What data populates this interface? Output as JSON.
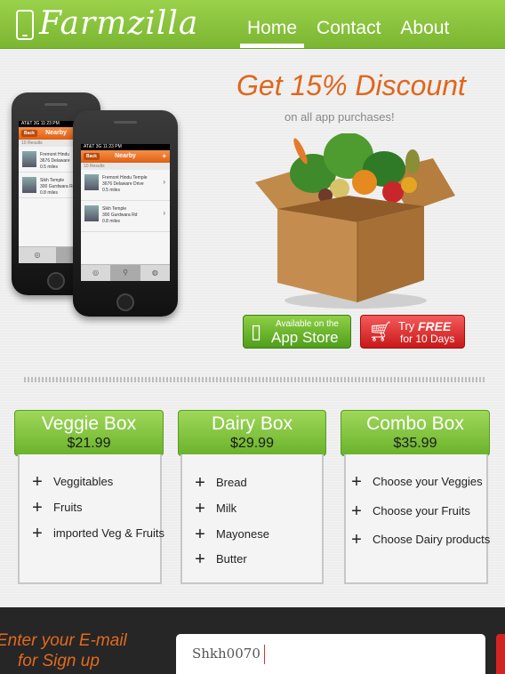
{
  "header": {
    "logo_text": "Farmzilla",
    "nav": [
      {
        "label": "Home",
        "active": true
      },
      {
        "label": "Contact",
        "active": false
      },
      {
        "label": "About",
        "active": false
      }
    ],
    "brand_color": "#86c23c"
  },
  "promo": {
    "title": "Get 15% Discount",
    "subtitle": "on all app purchases!"
  },
  "phone_back": {
    "status": "AT&T 3G   11:23 PM",
    "back": "Back",
    "title": "Nearby",
    "results": "10 Results",
    "rows": [
      {
        "name": "Fremont Hindu",
        "line2": "3676 Delaware",
        "line3": "0.5 miles"
      },
      {
        "name": "Sikh Temple",
        "line2": "300 Gurdwara Rd",
        "line3": "0.8 miles"
      }
    ]
  },
  "phone_front": {
    "status": "AT&T 3G   11:23 PM",
    "back": "Back",
    "title": "Nearby",
    "plus": "+",
    "results": "10 Results",
    "rows": [
      {
        "name": "Fremont Hindu Temple",
        "line2": "3676 Delaware Drive",
        "line3": "0.5 miles"
      },
      {
        "name": "Sikh Temple",
        "line2": "300 Gurdwara Rd",
        "line3": "0.8 miles"
      }
    ]
  },
  "buttons": {
    "appstore_small": "Available on the",
    "appstore_big": "App Store",
    "free_try": "Try",
    "free_word": "FREE",
    "free_days": "for 10 Days"
  },
  "plans": [
    {
      "name": "Veggie Box",
      "price": "$21.99",
      "items": [
        "Veggitables",
        "Fruits",
        "imported Veg & Fruits"
      ]
    },
    {
      "name": "Dairy Box",
      "price": "$29.99",
      "items": [
        "Bread",
        "Milk",
        "Mayonese",
        "Butter"
      ]
    },
    {
      "name": "Combo Box",
      "price": "$35.99",
      "items": [
        "Choose your Veggies",
        "Choose your Fruits",
        "Choose Dairy products"
      ]
    }
  ],
  "footer": {
    "label_line1": "Enter your E-mail",
    "label_line2": "for Sign up",
    "input_value": "Shkh0070"
  }
}
